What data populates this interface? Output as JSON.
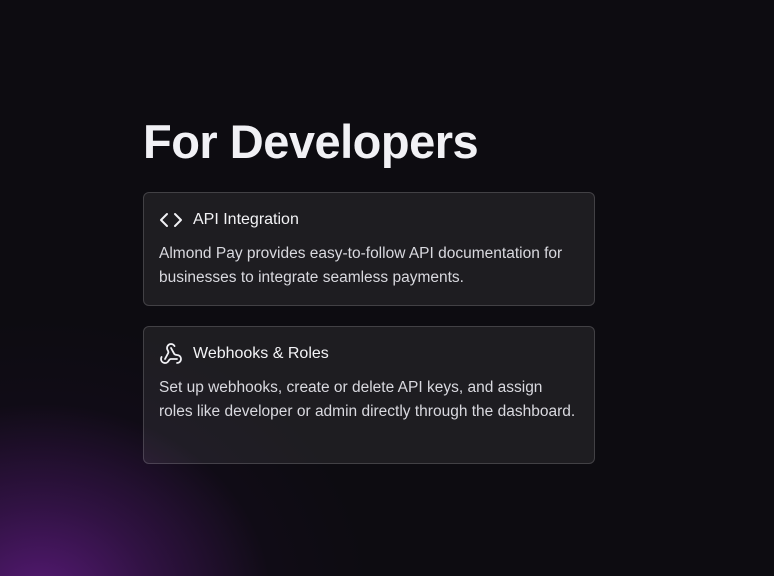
{
  "section": {
    "title": "For Developers"
  },
  "cards": [
    {
      "icon": "code-brackets-icon",
      "title": "API Integration",
      "description": "Almond Pay provides easy-to-follow API documentation for businesses to integrate seamless payments."
    },
    {
      "icon": "webhook-icon",
      "title": "Webhooks & Roles",
      "description": "Set up webhooks, create or delete API keys, and assign roles like developer or admin directly through the dashboard."
    }
  ],
  "colors": {
    "background": "#0d0c11",
    "glow": "#6e1e96",
    "card_border": "rgba(255,255,255,0.16)",
    "text": "#f1f1f5"
  }
}
